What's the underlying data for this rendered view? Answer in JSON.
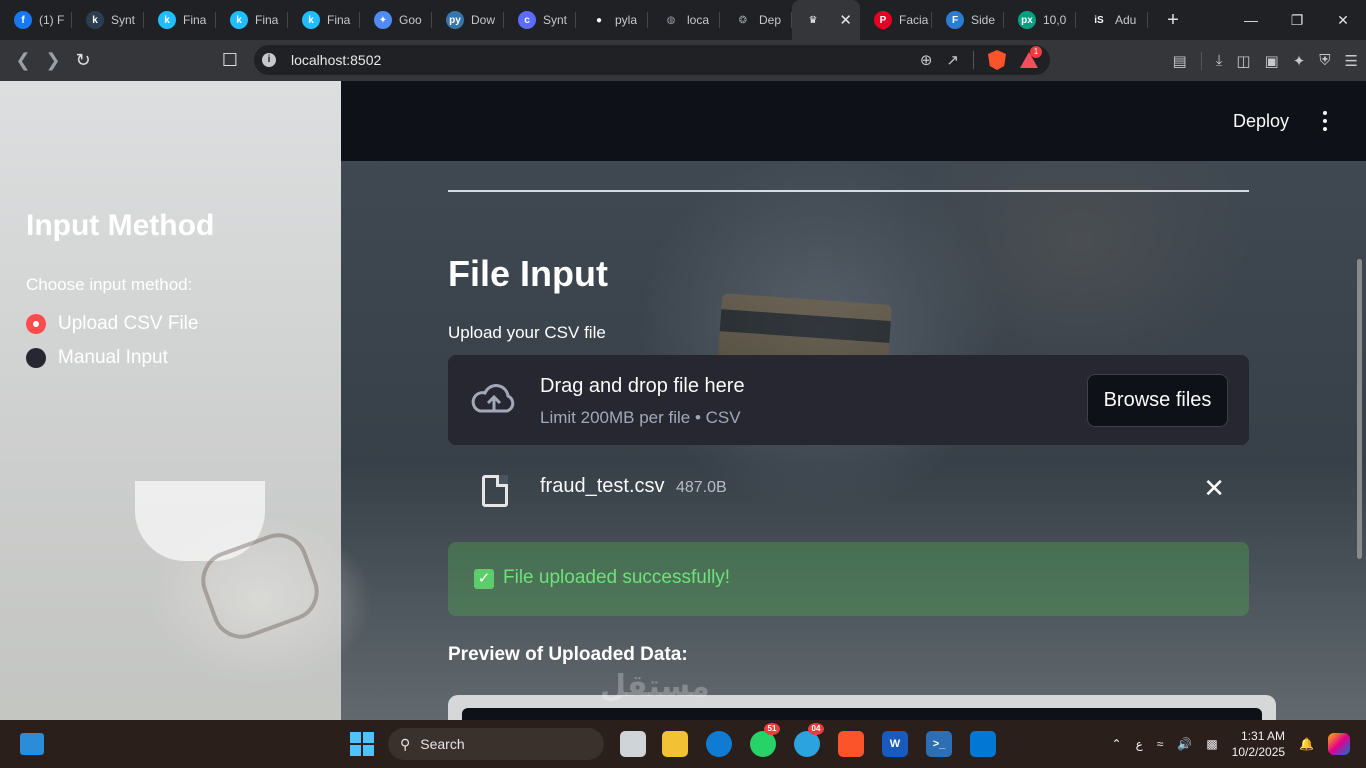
{
  "browser": {
    "tabs": [
      {
        "label": "(1) F",
        "icon": "facebook-icon",
        "color": "#1877f2",
        "glyph": "f"
      },
      {
        "label": "Synt",
        "icon": "k-logo-icon",
        "color": "#2c3e50",
        "glyph": "k"
      },
      {
        "label": "Fina",
        "icon": "kaggle-icon",
        "color": "#20beff",
        "glyph": "k"
      },
      {
        "label": "Fina",
        "icon": "kaggle-icon",
        "color": "#20beff",
        "glyph": "k"
      },
      {
        "label": "Fina",
        "icon": "kaggle-icon",
        "color": "#20beff",
        "glyph": "k"
      },
      {
        "label": "Goo",
        "icon": "gemini-icon",
        "color": "#4f8bf5",
        "glyph": "✦"
      },
      {
        "label": "Dow",
        "icon": "python-icon",
        "color": "#3776ab",
        "glyph": "py"
      },
      {
        "label": "Synt",
        "icon": "c-logo-icon",
        "color": "#5b6cff",
        "glyph": "c"
      },
      {
        "label": "pyla",
        "icon": "github-icon",
        "color": "#ffffff",
        "glyph": "●"
      },
      {
        "label": "loca",
        "icon": "globe-icon",
        "color": "#9aa0a6",
        "glyph": "◍"
      },
      {
        "label": "Dep",
        "icon": "openai-icon",
        "color": "#9aa0a6",
        "glyph": "❂"
      },
      {
        "label": "",
        "icon": "streamlit-icon",
        "color": "#ffffff",
        "glyph": "♛",
        "active": true
      },
      {
        "label": "Facia",
        "icon": "pinterest-icon",
        "color": "#e60023",
        "glyph": "P"
      },
      {
        "label": "Side",
        "icon": "forms-icon",
        "color": "#2b7cd3",
        "glyph": "F"
      },
      {
        "label": "10,0",
        "icon": "pexels-icon",
        "color": "#05a081",
        "glyph": "px"
      },
      {
        "label": "Adu",
        "icon": "istock-icon",
        "color": "#202124",
        "glyph": "iS"
      }
    ],
    "url": "localhost:8502",
    "shield_badge": "1"
  },
  "sidebar": {
    "heading": "Input Method",
    "radio_label": "Choose input method:",
    "options": [
      {
        "label": "Upload CSV File",
        "selected": true
      },
      {
        "label": "Manual Input",
        "selected": false
      }
    ]
  },
  "header": {
    "deploy_label": "Deploy"
  },
  "main": {
    "title": "File Input",
    "upload_label": "Upload your CSV file",
    "dropzone_main": "Drag and drop file here",
    "dropzone_sub": "Limit 200MB per file • CSV",
    "browse_label": "Browse files",
    "file_name": "fraud_test.csv",
    "file_size": "487.0B",
    "success_message": "File uploaded successfully!",
    "preview_heading": "Preview of Uploaded Data:"
  },
  "watermark": "مستقل",
  "taskbar": {
    "search_placeholder": "Search",
    "whatsapp_badge": "51",
    "telegram_badge": "04",
    "keyboard_lang": "ع",
    "time": "1:31 AM",
    "date": "10/2/2025"
  },
  "colors": {
    "accent": "#ff4b4b",
    "success_text": "#6fe07b",
    "header_bg": "#0e1117",
    "dropzone_bg": "#262730"
  }
}
